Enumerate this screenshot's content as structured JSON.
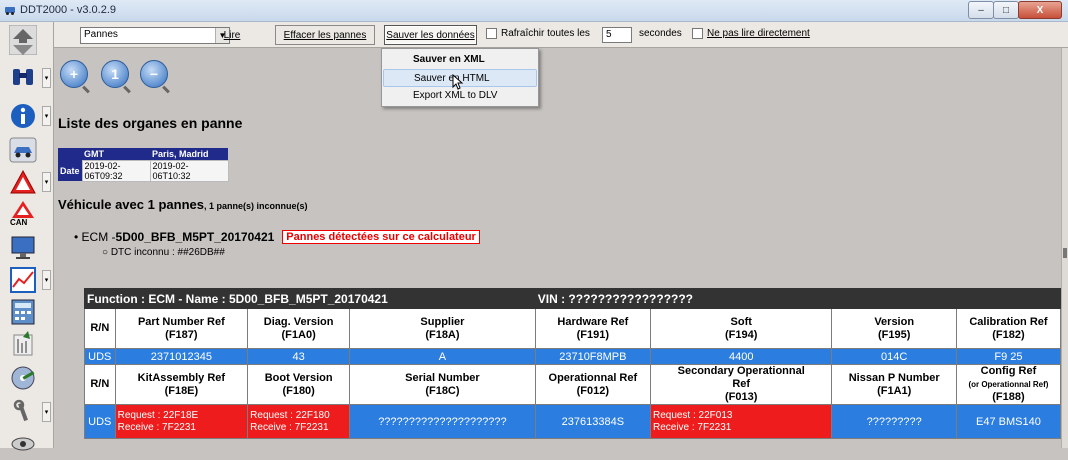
{
  "window": {
    "title": "DDT2000 - v3.0.2.9",
    "minimize": "–",
    "maximize": "□",
    "close": "X"
  },
  "toolbar": {
    "combo_value": "Pannes",
    "lire": "Lire",
    "effacer": "Effacer les pannes",
    "sauver": "Sauver les données",
    "refresh_label": "Rafraîchir toutes les",
    "refresh_value": "5",
    "seconds": "secondes",
    "no_direct_read": "Ne pas lire directement"
  },
  "menu": {
    "items": [
      "Sauver en XML",
      "Sauver en HTML",
      "Export XML to DLV"
    ]
  },
  "zoom": {
    "plus": "+",
    "one": "1",
    "minus": "−"
  },
  "report": {
    "heading": "Liste des organes en panne",
    "tz_header": [
      "",
      "GMT",
      "Paris, Madrid"
    ],
    "tz_row": [
      "Date",
      "2019-02-06T09:32",
      "2019-02-06T10:32"
    ],
    "vehicle_title": "Véhicule avec 1 pannes",
    "vehicle_sub": ", 1 panne(s) inconnue(s)",
    "ecu_prefix": "• ECM - ",
    "ecu_name": "5D00_BFB_M5PT_20170421",
    "ecu_badge": "Pannes détectées sur ce calculateur",
    "dtc": "○ DTC inconnu : ##26DB##"
  },
  "table": {
    "function_header": "Function : ECM   - Name : 5D00_BFB_M5PT_20170421",
    "vin_header": "VIN : ?????????????????",
    "row1_labels": [
      [
        "R/N",
        ""
      ],
      [
        "Part Number Ref",
        "(F187)"
      ],
      [
        "Diag. Version",
        "(F1A0)"
      ],
      [
        "Supplier",
        "(F18A)"
      ],
      [
        "Hardware Ref",
        "(F191)"
      ],
      [
        "Soft",
        "(F194)"
      ],
      [
        "Version",
        "(F195)"
      ],
      [
        "Calibration Ref",
        "(F182)"
      ]
    ],
    "row1_values": [
      "UDS",
      "2371012345",
      "43",
      "A",
      "23710F8MPB",
      "4400",
      "014C",
      "F9 25"
    ],
    "row2_labels": [
      [
        "R/N",
        "",
        ""
      ],
      [
        "KitAssembly Ref",
        "(F18E)",
        ""
      ],
      [
        "Boot Version",
        "(F180)",
        ""
      ],
      [
        "Serial Number",
        "(F18C)",
        ""
      ],
      [
        "Operationnal Ref",
        "(F012)",
        ""
      ],
      [
        "Secondary Operationnal",
        "Ref",
        "(F013)"
      ],
      [
        "Nissan P Number",
        "(F1A1)",
        ""
      ],
      [
        "Config Ref",
        "(or Operationnal Ref)",
        "(F188)"
      ]
    ],
    "row2_values": [
      [
        "UDS",
        ""
      ],
      [
        "Request : 22F18E",
        "Receive : 7F2231"
      ],
      [
        "Request : 22F180",
        "Receive : 7F2231"
      ],
      [
        "?????????????????????",
        ""
      ],
      [
        "237613384S",
        ""
      ],
      [
        "Request : 22F013",
        "Receive : 7F2231"
      ],
      [
        "?????????",
        ""
      ],
      [
        "E47 BMS140",
        ""
      ]
    ]
  },
  "left_tools": [
    "binoculars-icon",
    "info-icon",
    "car-icon",
    "warning-icon",
    "can-warning-icon",
    "monitor-icon",
    "chart-icon",
    "calculator-icon",
    "gauge-icon",
    "disc-icon",
    "wrench-icon",
    "eye-icon"
  ],
  "left_tool_labels": {
    "can": "CAN"
  },
  "colors": {
    "value_row": "#2b7ee0",
    "error_cell": "#ee1c1c",
    "header_row": "#333333",
    "tz_header": "#1f2a8a"
  }
}
